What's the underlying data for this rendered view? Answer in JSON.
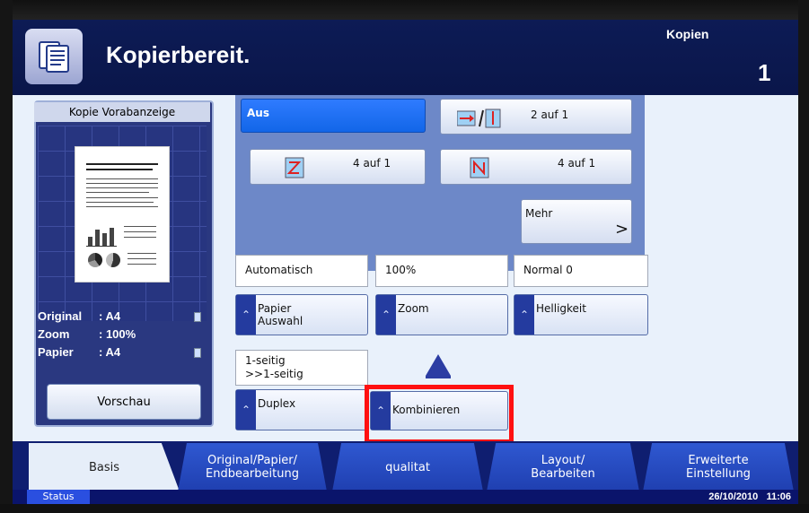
{
  "header": {
    "title": "Kopierbereit.",
    "copies_label": "Kopien",
    "copies_value": "1"
  },
  "preview_panel": {
    "title": "Kopie Vorabanzeige",
    "summary": [
      {
        "key": "Original",
        "value": ": A4"
      },
      {
        "key": "Zoom",
        "value": ": 100%"
      },
      {
        "key": "Papier",
        "value": ": A4"
      }
    ],
    "preview_button": "Vorschau"
  },
  "combine_options": {
    "off": "Aus",
    "two_in_one": "2 auf 1",
    "four_in_one_a": "4 auf 1",
    "four_in_one_b": "4 auf 1",
    "more": "Mehr",
    "more_arrow": ">"
  },
  "functions": {
    "paper": {
      "value": "Automatisch",
      "label_line1": "Papier",
      "label_line2": "Auswahl"
    },
    "zoom": {
      "value": "100%",
      "label": "Zoom"
    },
    "brightness": {
      "value": "Normal 0",
      "label": "Helligkeit"
    },
    "duplex": {
      "value_line1": "1-seitig",
      "value_line2": ">>1-seitig",
      "label": "Duplex"
    },
    "combine": {
      "label": "Kombinieren"
    }
  },
  "tabs": {
    "basis": "Basis",
    "original_line1": "Original/Papier/",
    "original_line2": "Endbearbeitung",
    "quality": "qualitat",
    "layout_line1": "Layout/",
    "layout_line2": "Bearbeiten",
    "advanced_line1": "Erweiterte",
    "advanced_line2": "Einstellung"
  },
  "status": {
    "label": "Status",
    "date": "26/10/2010",
    "time": "11:06"
  }
}
